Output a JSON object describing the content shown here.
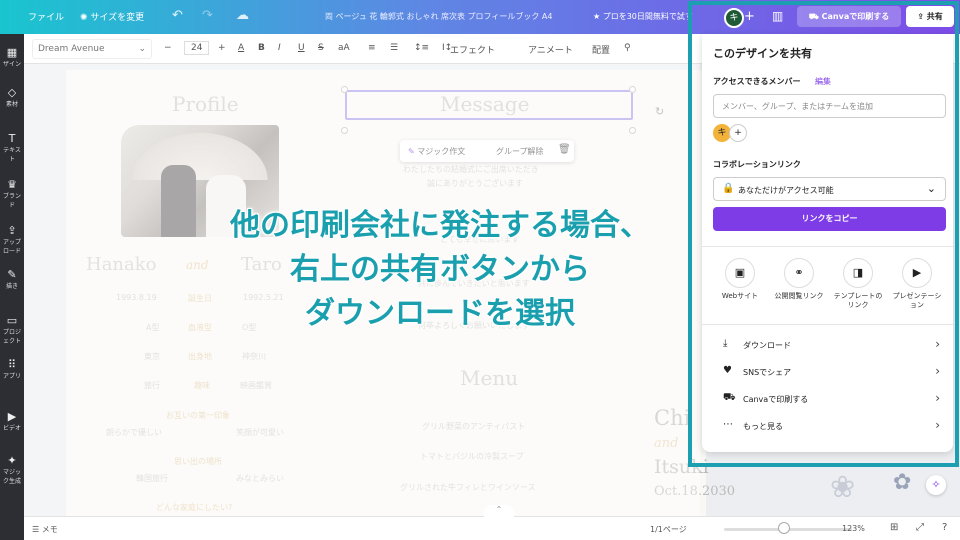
{
  "topbar": {
    "file": "ファイル",
    "resize": "サイズを変更",
    "doc_title": "両 ページュ 花 輪郭式 おしゃれ 席次表 プロフィールブック A4",
    "promo": "プロを30日間無料で試す",
    "avatar_initial": "キ",
    "print_label": "Canvaで印刷する",
    "share_label": "共有"
  },
  "leftrail": [
    "ザイン",
    "素材",
    "テキスト",
    "ブランド",
    "アップロード",
    "描き",
    "プロジェクト",
    "アプリ",
    "ビデオ",
    "マジック生成"
  ],
  "toolbar": {
    "font": "Dream Avenue",
    "font_size": "24",
    "effects": "エフェクト",
    "animate": "アニメート",
    "position": "配置"
  },
  "page": {
    "profile_title": "Profile",
    "message_title": "Message",
    "name_left": "Hanako",
    "name_and": "and",
    "name_right": "Taro",
    "birthday_left": "1993.8.19",
    "birthday_label": "誕生日",
    "birthday_right": "1992.5.21",
    "blood_left": "A型",
    "blood_label": "血液型",
    "blood_right": "O型",
    "home_left": "東京",
    "home_label": "出身地",
    "home_right": "神奈川",
    "hobby_left": "旅行",
    "hobby_label": "趣味",
    "hobby_right": "映画鑑賞",
    "first_impression": "お互いの第一印象",
    "imp_left": "朗らかで優しい",
    "imp_right": "笑顔が可愛い",
    "memory": "思い出の場所",
    "mem_left": "韓国旅行",
    "mem_right": "みなとみらい",
    "family": "どんな家庭にしたい?",
    "msg_line1": "わたしたちの結婚式にご出席いただき",
    "msg_line2": "誠にありがとうございます",
    "msg_line3": "とても幸せに思います",
    "msg_line4": "共に歩んでいきたいと思います",
    "msg_line5": "何卒よろしくお願いいたします",
    "menu_title": "Menu",
    "menu1": "グリル野菜のアンティパスト",
    "menu2": "トマトとバジルの冷製スープ",
    "menu3": "グリルされた牛フィレとワインソース",
    "card_name1": "Chi",
    "card_and": "and",
    "card_name2": "Itsuki",
    "card_date": "Oct.18.2030"
  },
  "magic_bar": {
    "magic_write": "マジック作文",
    "ungroup": "グループ解除"
  },
  "caption": {
    "line1": "他の印刷会社に発注する場合、",
    "line2": "右上の共有ボタンから",
    "line3": "ダウンロードを選択"
  },
  "share_panel": {
    "title": "このデザインを共有",
    "access_label": "アクセスできるメンバー",
    "edit_link": "編集",
    "input_placeholder": "メンバー、グループ、またはチームを追加",
    "member_initial": "キ",
    "collab_label": "コラボレーションリンク",
    "access_value": "あなただけがアクセス可能",
    "copy_button": "リンクをコピー",
    "options": [
      {
        "label": "Webサイト",
        "icon": "website-icon"
      },
      {
        "label": "公開閲覧リンク",
        "icon": "link-icon"
      },
      {
        "label": "テンプレートのリンク",
        "icon": "template-icon"
      },
      {
        "label": "プレゼンテーション",
        "icon": "presentation-icon"
      }
    ],
    "menu": [
      {
        "label": "ダウンロード",
        "icon": "download-icon"
      },
      {
        "label": "SNSでシェア",
        "icon": "heart-icon"
      },
      {
        "label": "Canvaで印刷する",
        "icon": "truck-icon"
      },
      {
        "label": "もっと見る",
        "icon": "more-icon"
      }
    ]
  },
  "statusbar": {
    "notes": "メモ",
    "page": "1/1ページ",
    "zoom": "123%"
  },
  "colors": {
    "caption": "#1a9fae",
    "frame": "#1d9fb2",
    "copy_button": "#7d3ce6",
    "avatar": "#f3b33a"
  }
}
